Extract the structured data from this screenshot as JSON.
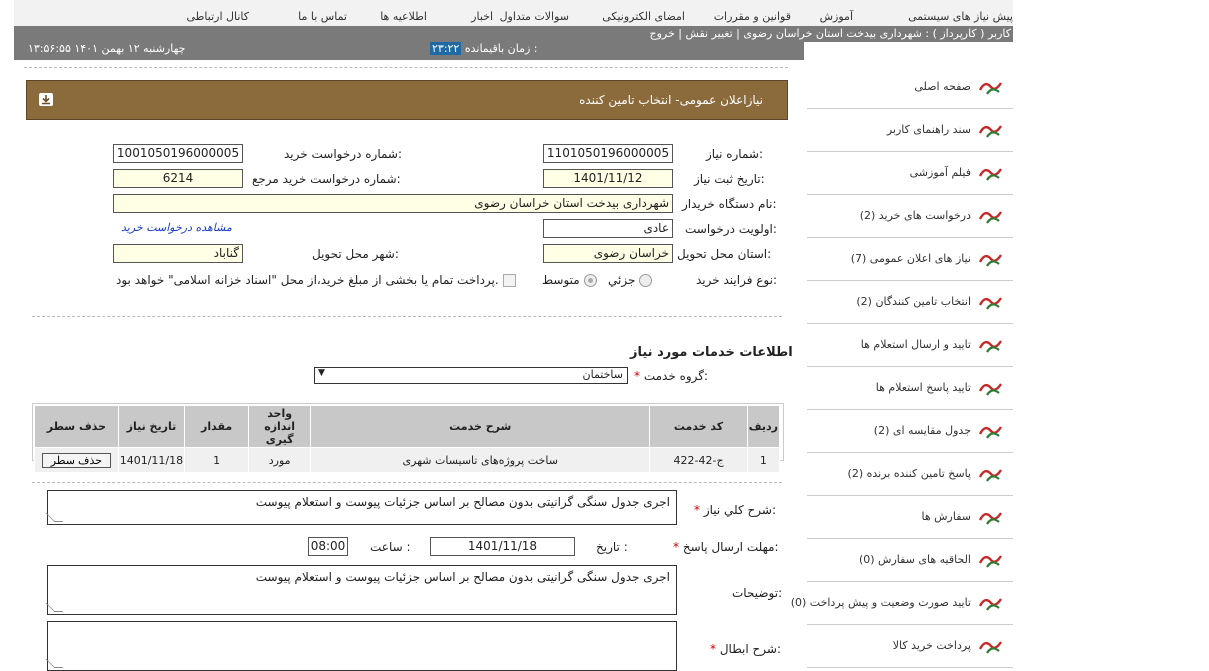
{
  "topnav": [
    "پیش نیاز های سیستمی",
    "آموزش",
    "قوانین و مقررات",
    "امضای الکترونیکی",
    "سوالات متداول",
    "اخبار",
    "اطلاعیه ها",
    "تماس با ما",
    "کانال ارتباطی"
  ],
  "userbar": {
    "text": "کاربر ( کارپرداز ) : شهرداری بیدخت استان خراسان رضوی | تغییر نقش | خروج"
  },
  "datebar": {
    "date": "۱۳:۵۶:۵۵   چهارشنبه ۱۲ بهمن ۱۴۰۱",
    "timer_label": "زمان باقیمانده :",
    "timer_value": "۲۳:۲۲"
  },
  "sidebar": [
    "صفحه اصلی",
    "سند راهنمای کاربر",
    "فیلم آموزشی",
    "درخواست های خرید (2)",
    "نیاز های اعلان عمومی (7)",
    "انتخاب تامین کنندگان (2)",
    "تایید و ارسال استعلام ها",
    "تایید پاسخ استعلام ها",
    "جدول مقایسه ای (2)",
    "پاسخ تامین کننده برنده (2)",
    "سفارش ها",
    "الحاقیه های سفارش (0)",
    "تایید صورت وضعیت و پیش پرداخت (0)",
    "پرداخت خرید کالا"
  ],
  "panel": {
    "title": "نیازاعلان عمومی- انتخاب تامین کننده"
  },
  "form": {
    "need_no_label": "شماره نیاز:",
    "need_no": "1101050196000005",
    "req_no_label": "شماره درخواست خرید:",
    "req_no": "1001050196000005",
    "reg_date_label": "تاریخ ثبت نیاز:",
    "reg_date": "1401/11/12",
    "ref_req_label": "شماره درخواست خرید مرجع:",
    "ref_req": "6214",
    "buyer_label": "نام دستگاه خریدار:",
    "buyer": "شهرداری بیدخت استان خراسان رضوی",
    "priority_label": "اولویت درخواست:",
    "priority": "عادی",
    "view_request": "مشاهده درخواست خرید",
    "province_label": "استان محل تحویل:",
    "province": "خراسان رضوی",
    "city_label": "شهر محل تحویل:",
    "city": "گناباد",
    "process_label": "نوع فرایند خرید:",
    "opt_partial": "جزئي",
    "opt_medium": "متوسط",
    "payment_note": "پرداخت تمام یا بخشی از مبلغ خرید،از محل \"اسناد خزانه اسلامی\" خواهد بود."
  },
  "services": {
    "heading": "اطلاعات خدمات مورد نیاز",
    "group_label": "گروه خدمت:",
    "group_value": "ساختمان",
    "columns": [
      "ردیف",
      "کد خدمت",
      "شرح خدمت",
      "واحد اندازه گیری",
      "مقدار",
      "تاریخ نیاز",
      "حذف سطر"
    ],
    "rows": [
      {
        "row": "1",
        "code": "ج-42-422",
        "desc": "ساخت پروژه‌های تاسیسات شهری",
        "unit": "مورد",
        "qty": "1",
        "date": "1401/11/18",
        "del": "حذف سطر"
      }
    ]
  },
  "details": {
    "general_label": "شرح کلي نیاز:",
    "general": "اجری جدول سنگی گرانیتی بدون مصالح بر اساس  جزئیات پیوست و استعلام پیوست",
    "deadline_label": "مهلت ارسال پاسخ:",
    "date_label": "تاریخ :",
    "date": "1401/11/18",
    "time_label": "ساعت :",
    "time": "08:00",
    "notes_label": "توضیحات:",
    "notes": "اجری جدول سنگی گرانیتی بدون مصالح بر اساس  جزئیات پیوست و استعلام پیوست",
    "cancel_label": "شرح ابطال:",
    "cancel": ""
  }
}
